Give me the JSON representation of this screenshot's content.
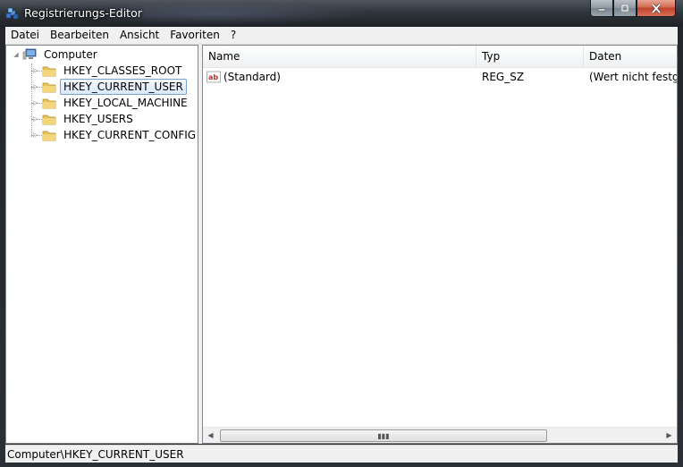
{
  "window": {
    "title": "Registrierungs-Editor"
  },
  "menu": [
    "Datei",
    "Bearbeiten",
    "Ansicht",
    "Favoriten",
    "?"
  ],
  "tree": {
    "root": "Computer",
    "items": [
      "HKEY_CLASSES_ROOT",
      "HKEY_CURRENT_USER",
      "HKEY_LOCAL_MACHINE",
      "HKEY_USERS",
      "HKEY_CURRENT_CONFIG"
    ],
    "selected": "HKEY_CURRENT_USER"
  },
  "list": {
    "columns": [
      "Name",
      "Typ",
      "Daten"
    ],
    "rows": [
      {
        "name": "(Standard)",
        "type": "REG_SZ",
        "data": "(Wert nicht festgelegt)"
      }
    ]
  },
  "status": {
    "path": "Computer\\HKEY_CURRENT_USER"
  },
  "icons": {
    "app": "registry-editor-icon",
    "computer": "computer-icon",
    "folder": "folder-icon",
    "value": "string-value-icon"
  },
  "colors": {
    "selection_border": "#7da2ce",
    "folder": "#e8c35a",
    "close_button": "#c0402a"
  }
}
